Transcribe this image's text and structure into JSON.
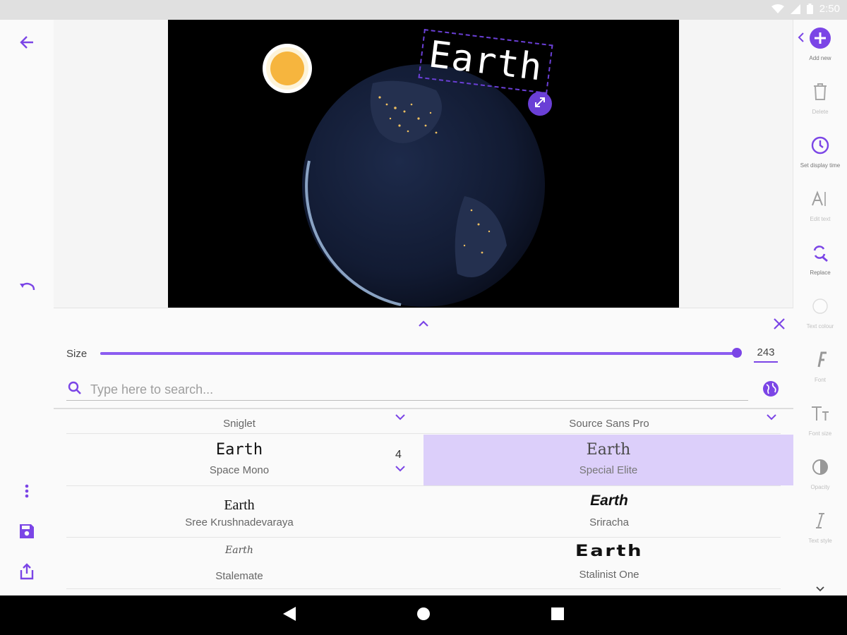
{
  "status": {
    "time": "2:50"
  },
  "canvas": {
    "overlay_text": "Earth"
  },
  "right_tools": [
    {
      "label": "Add new",
      "icon": "add-circle-icon"
    },
    {
      "label": "Delete",
      "icon": "trash-icon"
    },
    {
      "label": "Set display time",
      "icon": "clock-icon"
    },
    {
      "label": "Edit text",
      "icon": "text-cursor-icon"
    },
    {
      "label": "Replace",
      "icon": "replace-search-icon"
    },
    {
      "label": "Text colour",
      "icon": "color-circle-icon"
    },
    {
      "label": "Font",
      "icon": "font-icon"
    },
    {
      "label": "Font size",
      "icon": "font-size-icon"
    },
    {
      "label": "Opacity",
      "icon": "opacity-icon"
    },
    {
      "label": "Text style",
      "icon": "italic-icon"
    }
  ],
  "panel": {
    "size_label": "Size",
    "size_value": "243",
    "size_fraction": 0.998,
    "search_placeholder": "Type here to search...",
    "fonts": [
      {
        "sample": "",
        "name": "Sniglet"
      },
      {
        "sample": "",
        "name": "Source Sans Pro"
      },
      {
        "sample": "Earth",
        "name": "Space Mono",
        "badge": "4"
      },
      {
        "sample": "Earth",
        "name": "Special Elite",
        "selected": true
      },
      {
        "sample": "Earth",
        "name": "Sree Krushnadevaraya"
      },
      {
        "sample": "Earth",
        "name": "Sriracha"
      },
      {
        "sample": "Earth",
        "name": "Stalemate"
      },
      {
        "sample": "Earth",
        "name": "Stalinist One"
      }
    ]
  },
  "colors": {
    "accent": "#7b45e6",
    "selected_row": "#dccffa"
  }
}
